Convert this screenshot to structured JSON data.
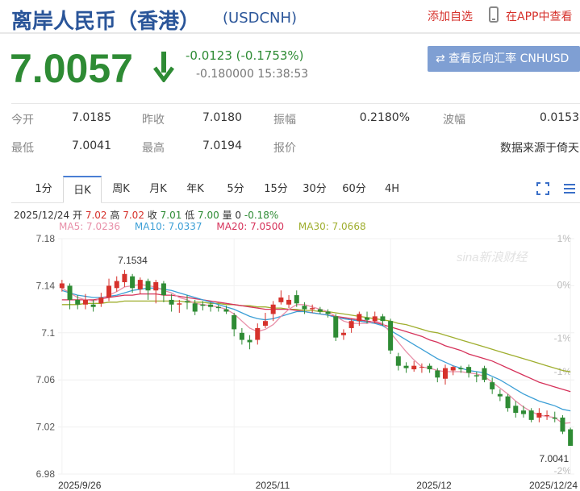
{
  "header": {
    "title": "离岸人民币（香港）",
    "code": "(USDCNH)",
    "add_watch": "添加自选",
    "app_view": "在APP中查看"
  },
  "quote": {
    "price": "7.0057",
    "change": "-0.0123 (-0.1753%)",
    "sub": "-0.180000 15:38:53",
    "reverse_button": "⇄ 查看反向汇率 CNHUSD"
  },
  "stats": {
    "open_label": "今开",
    "open": "7.0185",
    "prev_close_label": "昨收",
    "prev_close": "7.0180",
    "amplitude_label": "振幅",
    "amplitude": "0.2180%",
    "volatility_label": "波幅",
    "volatility": "0.0153",
    "low_label": "最低",
    "low": "7.0041",
    "high_label": "最高",
    "high": "7.0194",
    "quote_label": "报价",
    "source": "数据来源于倚天"
  },
  "tabs": [
    "1分",
    "日K",
    "周K",
    "月K",
    "年K",
    "5分",
    "15分",
    "30分",
    "60分",
    "4H"
  ],
  "active_tab": "日K",
  "ohlc_line": {
    "date": "2025/12/24",
    "open_label": "开",
    "open": "7.02",
    "high_label": "高",
    "high": "7.02",
    "close_label": "收",
    "close": "7.01",
    "low_label": "低",
    "low": "7.00",
    "vol_label": "量",
    "vol": "0",
    "pct": "-0.18%"
  },
  "ma_legend": {
    "ma5": "MA5: 7.0236",
    "ma10": "MA10: 7.0337",
    "ma20": "MA20: 7.0500",
    "ma30": "MA30: 7.0668"
  },
  "colors": {
    "up": "#d6322c",
    "down": "#2e8b34",
    "ma5": "#e88fa8",
    "ma10": "#3c9fd6",
    "ma20": "#d6325a",
    "ma30": "#9fae2e"
  },
  "chart_data": {
    "type": "candlestick",
    "y_ticks": [
      "7.18",
      "7.14",
      "7.1",
      "7.06",
      "7.02",
      "6.98"
    ],
    "pct_ticks": [
      "1%",
      "0%",
      "-1%",
      "-1%",
      "-2%"
    ],
    "x_ticks": [
      "2025/9/26",
      "2025/11",
      "2025/12",
      "2025/12/24"
    ],
    "ylim": [
      6.98,
      7.18
    ],
    "max_label": "7.1534",
    "min_label": "7.0041",
    "watermark": "sina新浪财经",
    "candles": [
      {
        "o": 7.138,
        "c": 7.142,
        "h": 7.145,
        "l": 7.135
      },
      {
        "o": 7.14,
        "c": 7.128,
        "h": 7.142,
        "l": 7.12
      },
      {
        "o": 7.128,
        "c": 7.124,
        "h": 7.132,
        "l": 7.12
      },
      {
        "o": 7.124,
        "c": 7.128,
        "h": 7.133,
        "l": 7.12
      },
      {
        "o": 7.124,
        "c": 7.122,
        "h": 7.128,
        "l": 7.118
      },
      {
        "o": 7.125,
        "c": 7.13,
        "h": 7.134,
        "l": 7.122
      },
      {
        "o": 7.13,
        "c": 7.14,
        "h": 7.146,
        "l": 7.127
      },
      {
        "o": 7.138,
        "c": 7.144,
        "h": 7.148,
        "l": 7.135
      },
      {
        "o": 7.143,
        "c": 7.15,
        "h": 7.1534,
        "l": 7.139
      },
      {
        "o": 7.148,
        "c": 7.138,
        "h": 7.15,
        "l": 7.134
      },
      {
        "o": 7.137,
        "c": 7.145,
        "h": 7.147,
        "l": 7.133
      },
      {
        "o": 7.144,
        "c": 7.136,
        "h": 7.146,
        "l": 7.128
      },
      {
        "o": 7.136,
        "c": 7.143,
        "h": 7.145,
        "l": 7.125
      },
      {
        "o": 7.142,
        "c": 7.132,
        "h": 7.144,
        "l": 7.126
      },
      {
        "o": 7.128,
        "c": 7.124,
        "h": 7.133,
        "l": 7.118
      },
      {
        "o": 7.124,
        "c": 7.125,
        "h": 7.128,
        "l": 7.117
      },
      {
        "o": 7.127,
        "c": 7.126,
        "h": 7.132,
        "l": 7.12
      },
      {
        "o": 7.125,
        "c": 7.118,
        "h": 7.128,
        "l": 7.115
      },
      {
        "o": 7.124,
        "c": 7.123,
        "h": 7.127,
        "l": 7.119
      },
      {
        "o": 7.124,
        "c": 7.122,
        "h": 7.126,
        "l": 7.118
      },
      {
        "o": 7.122,
        "c": 7.121,
        "h": 7.124,
        "l": 7.118
      },
      {
        "o": 7.12,
        "c": 7.118,
        "h": 7.123,
        "l": 7.116
      },
      {
        "o": 7.115,
        "c": 7.103,
        "h": 7.117,
        "l": 7.097
      },
      {
        "o": 7.1,
        "c": 7.094,
        "h": 7.104,
        "l": 7.09
      },
      {
        "o": 7.094,
        "c": 7.092,
        "h": 7.098,
        "l": 7.086
      },
      {
        "o": 7.094,
        "c": 7.104,
        "h": 7.108,
        "l": 7.09
      },
      {
        "o": 7.106,
        "c": 7.11,
        "h": 7.117,
        "l": 7.104
      },
      {
        "o": 7.116,
        "c": 7.124,
        "h": 7.127,
        "l": 7.11
      },
      {
        "o": 7.126,
        "c": 7.13,
        "h": 7.136,
        "l": 7.124
      },
      {
        "o": 7.124,
        "c": 7.128,
        "h": 7.132,
        "l": 7.121
      },
      {
        "o": 7.132,
        "c": 7.125,
        "h": 7.136,
        "l": 7.122
      },
      {
        "o": 7.123,
        "c": 7.12,
        "h": 7.126,
        "l": 7.116
      },
      {
        "o": 7.12,
        "c": 7.121,
        "h": 7.124,
        "l": 7.117
      },
      {
        "o": 7.12,
        "c": 7.118,
        "h": 7.122,
        "l": 7.116
      },
      {
        "o": 7.118,
        "c": 7.116,
        "h": 7.12,
        "l": 7.113
      },
      {
        "o": 7.114,
        "c": 7.096,
        "h": 7.116,
        "l": 7.093
      },
      {
        "o": 7.098,
        "c": 7.1,
        "h": 7.103,
        "l": 7.094
      },
      {
        "o": 7.104,
        "c": 7.11,
        "h": 7.112,
        "l": 7.1
      },
      {
        "o": 7.11,
        "c": 7.116,
        "h": 7.118,
        "l": 7.106
      },
      {
        "o": 7.113,
        "c": 7.111,
        "h": 7.118,
        "l": 7.108
      },
      {
        "o": 7.11,
        "c": 7.114,
        "h": 7.118,
        "l": 7.108
      },
      {
        "o": 7.114,
        "c": 7.11,
        "h": 7.116,
        "l": 7.106
      },
      {
        "o": 7.11,
        "c": 7.085,
        "h": 7.112,
        "l": 7.082
      },
      {
        "o": 7.08,
        "c": 7.072,
        "h": 7.083,
        "l": 7.068
      },
      {
        "o": 7.072,
        "c": 7.07,
        "h": 7.075,
        "l": 7.066
      },
      {
        "o": 7.069,
        "c": 7.072,
        "h": 7.076,
        "l": 7.067
      },
      {
        "o": 7.071,
        "c": 7.071,
        "h": 7.074,
        "l": 7.066
      },
      {
        "o": 7.072,
        "c": 7.069,
        "h": 7.074,
        "l": 7.066
      },
      {
        "o": 7.068,
        "c": 7.062,
        "h": 7.07,
        "l": 7.058
      },
      {
        "o": 7.061,
        "c": 7.07,
        "h": 7.073,
        "l": 7.056
      },
      {
        "o": 7.068,
        "c": 7.071,
        "h": 7.072,
        "l": 7.064
      },
      {
        "o": 7.07,
        "c": 7.069,
        "h": 7.072,
        "l": 7.066
      },
      {
        "o": 7.071,
        "c": 7.066,
        "h": 7.073,
        "l": 7.062
      },
      {
        "o": 7.064,
        "c": 7.063,
        "h": 7.067,
        "l": 7.058
      },
      {
        "o": 7.07,
        "c": 7.06,
        "h": 7.072,
        "l": 7.058
      },
      {
        "o": 7.058,
        "c": 7.052,
        "h": 7.062,
        "l": 7.048
      },
      {
        "o": 7.048,
        "c": 7.046,
        "h": 7.052,
        "l": 7.042
      },
      {
        "o": 7.046,
        "c": 7.036,
        "h": 7.048,
        "l": 7.033
      },
      {
        "o": 7.038,
        "c": 7.032,
        "h": 7.042,
        "l": 7.028
      },
      {
        "o": 7.034,
        "c": 7.031,
        "h": 7.038,
        "l": 7.028
      },
      {
        "o": 7.034,
        "c": 7.026,
        "h": 7.036,
        "l": 7.024
      },
      {
        "o": 7.028,
        "c": 7.032,
        "h": 7.036,
        "l": 7.024
      },
      {
        "o": 7.03,
        "c": 7.03,
        "h": 7.034,
        "l": 7.026
      },
      {
        "o": 7.028,
        "c": 7.027,
        "h": 7.033,
        "l": 7.024
      },
      {
        "o": 7.028,
        "c": 7.016,
        "h": 7.03,
        "l": 7.014
      },
      {
        "o": 7.018,
        "c": 7.004,
        "h": 7.0194,
        "l": 7.0041
      }
    ],
    "ma5": [
      7.138,
      7.134,
      7.13,
      7.128,
      7.127,
      7.129,
      7.132,
      7.135,
      7.139,
      7.14,
      7.141,
      7.14,
      7.139,
      7.136,
      7.134,
      7.13,
      7.128,
      7.125,
      7.124,
      7.123,
      7.122,
      7.12,
      7.116,
      7.11,
      7.104,
      7.101,
      7.103,
      7.107,
      7.114,
      7.12,
      7.124,
      7.124,
      7.122,
      7.12,
      7.118,
      7.114,
      7.11,
      7.108,
      7.108,
      7.108,
      7.11,
      7.108,
      7.1,
      7.092,
      7.084,
      7.077,
      7.071,
      7.07,
      7.068,
      7.067,
      7.067,
      7.067,
      7.066,
      7.065,
      7.063,
      7.058,
      7.053,
      7.048,
      7.042,
      7.037,
      7.033,
      7.03,
      7.029,
      7.028,
      7.023,
      7.0236
    ],
    "ma10": [
      7.136,
      7.134,
      7.132,
      7.131,
      7.13,
      7.13,
      7.131,
      7.132,
      7.134,
      7.136,
      7.137,
      7.138,
      7.138,
      7.137,
      7.136,
      7.134,
      7.132,
      7.13,
      7.128,
      7.126,
      7.124,
      7.122,
      7.12,
      7.117,
      7.114,
      7.112,
      7.111,
      7.112,
      7.114,
      7.116,
      7.118,
      7.118,
      7.117,
      7.116,
      7.115,
      7.113,
      7.112,
      7.111,
      7.11,
      7.109,
      7.108,
      7.106,
      7.102,
      7.098,
      7.094,
      7.09,
      7.086,
      7.082,
      7.078,
      7.075,
      7.072,
      7.07,
      7.068,
      7.067,
      7.066,
      7.063,
      7.06,
      7.056,
      7.052,
      7.048,
      7.045,
      7.042,
      7.04,
      7.038,
      7.035,
      7.0337
    ],
    "ma20": [
      7.128,
      7.128,
      7.128,
      7.128,
      7.128,
      7.129,
      7.13,
      7.131,
      7.132,
      7.132,
      7.133,
      7.133,
      7.133,
      7.132,
      7.132,
      7.131,
      7.13,
      7.129,
      7.128,
      7.127,
      7.126,
      7.125,
      7.124,
      7.123,
      7.122,
      7.121,
      7.12,
      7.12,
      7.12,
      7.12,
      7.119,
      7.118,
      7.117,
      7.116,
      7.115,
      7.114,
      7.113,
      7.112,
      7.111,
      7.11,
      7.109,
      7.107,
      7.105,
      7.103,
      7.101,
      7.099,
      7.097,
      7.094,
      7.092,
      7.089,
      7.087,
      7.085,
      7.082,
      7.08,
      7.078,
      7.076,
      7.073,
      7.07,
      7.067,
      7.064,
      7.061,
      7.058,
      7.056,
      7.054,
      7.052,
      7.05
    ],
    "ma30": [
      7.124,
      7.124,
      7.124,
      7.125,
      7.125,
      7.125,
      7.126,
      7.126,
      7.127,
      7.127,
      7.127,
      7.127,
      7.127,
      7.127,
      7.127,
      7.127,
      7.126,
      7.126,
      7.126,
      7.125,
      7.125,
      7.124,
      7.124,
      7.123,
      7.123,
      7.122,
      7.122,
      7.121,
      7.121,
      7.12,
      7.12,
      7.119,
      7.119,
      7.118,
      7.118,
      7.117,
      7.116,
      7.115,
      7.114,
      7.113,
      7.112,
      7.111,
      7.11,
      7.108,
      7.107,
      7.105,
      7.103,
      7.101,
      7.1,
      7.098,
      7.096,
      7.094,
      7.092,
      7.09,
      7.088,
      7.086,
      7.084,
      7.082,
      7.08,
      7.078,
      7.076,
      7.074,
      7.072,
      7.07,
      7.068,
      7.0668
    ]
  }
}
